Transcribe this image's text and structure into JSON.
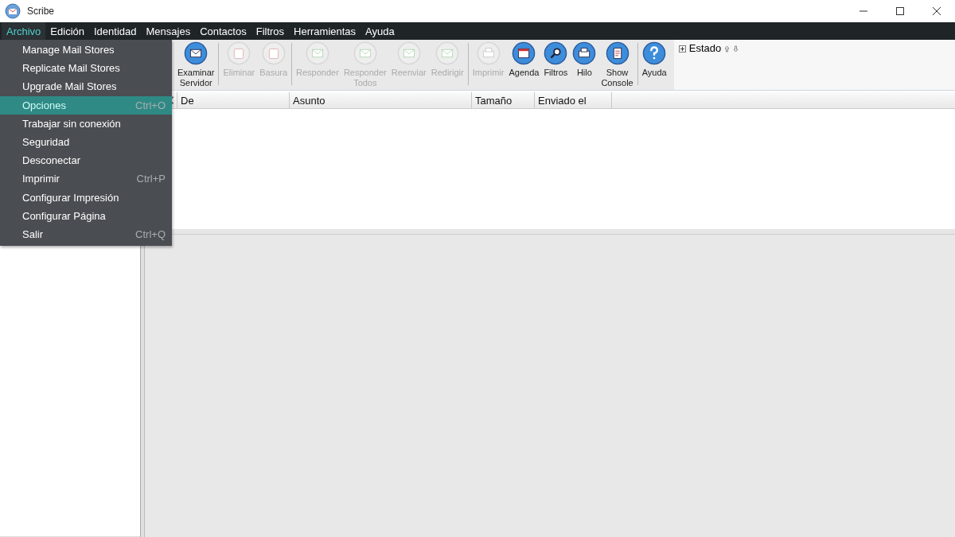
{
  "window": {
    "title": "Scribe"
  },
  "menubar": [
    {
      "label": "Archivo",
      "selected": true
    },
    {
      "label": "Edición",
      "selected": false
    },
    {
      "label": "Identidad",
      "selected": false
    },
    {
      "label": "Mensajes",
      "selected": false
    },
    {
      "label": "Contactos",
      "selected": false
    },
    {
      "label": "Filtros",
      "selected": false
    },
    {
      "label": "Herramientas",
      "selected": false
    },
    {
      "label": "Ayuda",
      "selected": false
    }
  ],
  "menu": [
    {
      "label": "Manage Mail Stores",
      "selected": false
    },
    {
      "label": "Replicate Mail Stores",
      "selected": false
    },
    {
      "label": "Upgrade Mail Stores",
      "selected": false
    },
    {
      "label": "Opciones",
      "shortcut": "Ctrl+O",
      "selected": true
    },
    {
      "label": "Trabajar sin conexión",
      "selected": false
    },
    {
      "label": "Seguridad",
      "selected": false
    },
    {
      "label": "Desconectar",
      "selected": false
    },
    {
      "label": "Imprimir",
      "shortcut": "Ctrl+P",
      "selected": false
    },
    {
      "label": "Configurar Impresión",
      "selected": false
    },
    {
      "label": "Configurar Página",
      "selected": false
    },
    {
      "label": "Salir",
      "shortcut": "Ctrl+Q",
      "selected": false
    }
  ],
  "toolbar": [
    [
      {
        "label": [
          "Examinar",
          "Servidor"
        ],
        "kind": "mail",
        "disabled": false
      }
    ],
    [
      {
        "label": [
          "Eliminar"
        ],
        "kind": "trash",
        "disabled": true
      },
      {
        "label": [
          "Basura"
        ],
        "kind": "trash",
        "disabled": true
      }
    ],
    [
      {
        "label": [
          "Responder"
        ],
        "kind": "mail",
        "disabled": true
      },
      {
        "label": [
          "Responder",
          "Todos"
        ],
        "kind": "mail",
        "disabled": true
      },
      {
        "label": [
          "Reenviar"
        ],
        "kind": "mail",
        "disabled": true
      },
      {
        "label": [
          "Redirigir"
        ],
        "kind": "mail",
        "disabled": true
      }
    ],
    [
      {
        "label": [
          "Imprimir"
        ],
        "kind": "printer",
        "disabled": true
      },
      {
        "label": [
          "Agenda"
        ],
        "kind": "calendar",
        "disabled": false
      },
      {
        "label": [
          "Filtros"
        ],
        "kind": "search",
        "disabled": false
      },
      {
        "label": [
          "Hilo"
        ],
        "kind": "printer",
        "disabled": false
      },
      {
        "label": [
          "Show",
          "Console"
        ],
        "kind": "document",
        "disabled": false
      }
    ],
    [
      {
        "label": [
          "Ayuda"
        ],
        "kind": "help",
        "disabled": false
      }
    ]
  ],
  "status_panel": {
    "label": "Estado"
  },
  "message_list": {
    "columns": [
      "De",
      "Asunto",
      "Tamaño",
      "Enviado el"
    ]
  }
}
